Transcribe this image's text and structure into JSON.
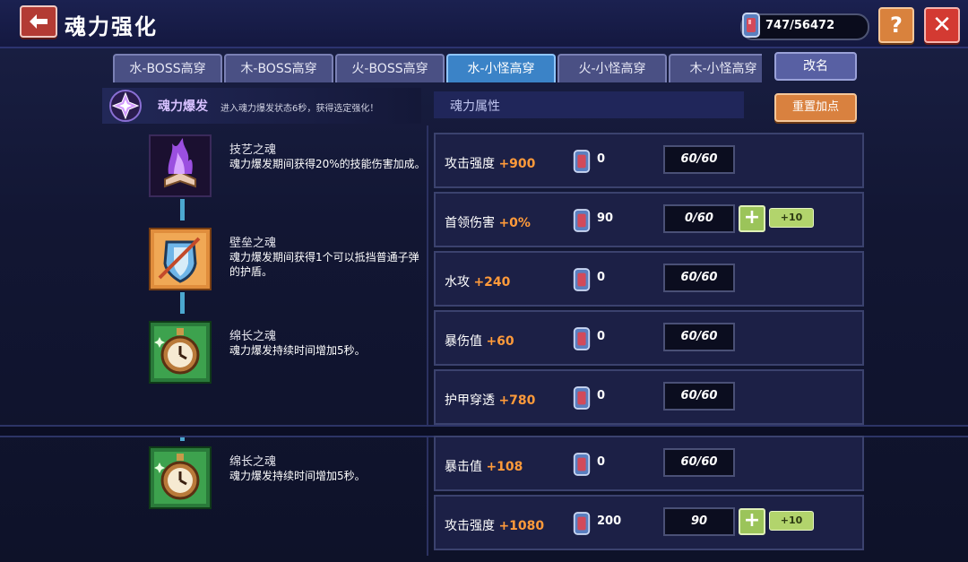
{
  "header": {
    "title": "魂力强化",
    "currency_value": "747/56472",
    "help_label": "?",
    "close_label": "✕"
  },
  "tabs": [
    {
      "label": "水-BOSS高穿",
      "active": false
    },
    {
      "label": "木-BOSS高穿",
      "active": false
    },
    {
      "label": "火-BOSS高穿",
      "active": false
    },
    {
      "label": "水-小怪高穿",
      "active": true
    },
    {
      "label": "火-小怪高穿",
      "active": false
    },
    {
      "label": "木-小怪高穿",
      "active": false
    }
  ],
  "rename_label": "改名",
  "burst": {
    "title": "魂力爆发",
    "desc": "进入魂力爆发状态6秒，获得选定强化！"
  },
  "attributes_header": "魂力属性",
  "reset_label": "重置加点",
  "souls": [
    {
      "name": "技艺之魂",
      "desc": "魂力爆发期间获得20%的技能伤害加成。",
      "icon": "purple-flame-book-icon"
    },
    {
      "name": "壁垒之魂",
      "desc": "魂力爆发期间获得1个可以抵挡普通子弹的护盾。",
      "icon": "shield-icon"
    },
    {
      "name": "绵长之魂",
      "desc": "魂力爆发持续时间增加5秒。",
      "icon": "pocket-watch-icon"
    },
    {
      "name": "绵长之魂",
      "desc": "魂力爆发持续时间增加5秒。",
      "icon": "pocket-watch-icon"
    }
  ],
  "stats": [
    {
      "name": "攻击强度",
      "bonus": "+900",
      "cost": "0",
      "level": "60/60",
      "upgradable": false
    },
    {
      "name": "首领伤害",
      "bonus": "+0%",
      "cost": "90",
      "level": "0/60",
      "upgradable": true,
      "plus10": "+10"
    },
    {
      "name": "水攻",
      "bonus": "+240",
      "cost": "0",
      "level": "60/60",
      "upgradable": false
    },
    {
      "name": "暴伤值",
      "bonus": "+60",
      "cost": "0",
      "level": "60/60",
      "upgradable": false
    },
    {
      "name": "护甲穿透",
      "bonus": "+780",
      "cost": "0",
      "level": "60/60",
      "upgradable": false
    },
    {
      "name": "暴击值",
      "bonus": "+108",
      "cost": "0",
      "level": "60/60",
      "upgradable": false
    },
    {
      "name": "攻击强度",
      "bonus": "+1080",
      "cost": "200",
      "level": "90",
      "upgradable": true,
      "plus10": "+10"
    }
  ],
  "colors": {
    "active_tab": "#3b83c7",
    "bonus_text": "#ff9a3a",
    "reset_button": "#d9813f",
    "close_button": "#d33a32"
  }
}
